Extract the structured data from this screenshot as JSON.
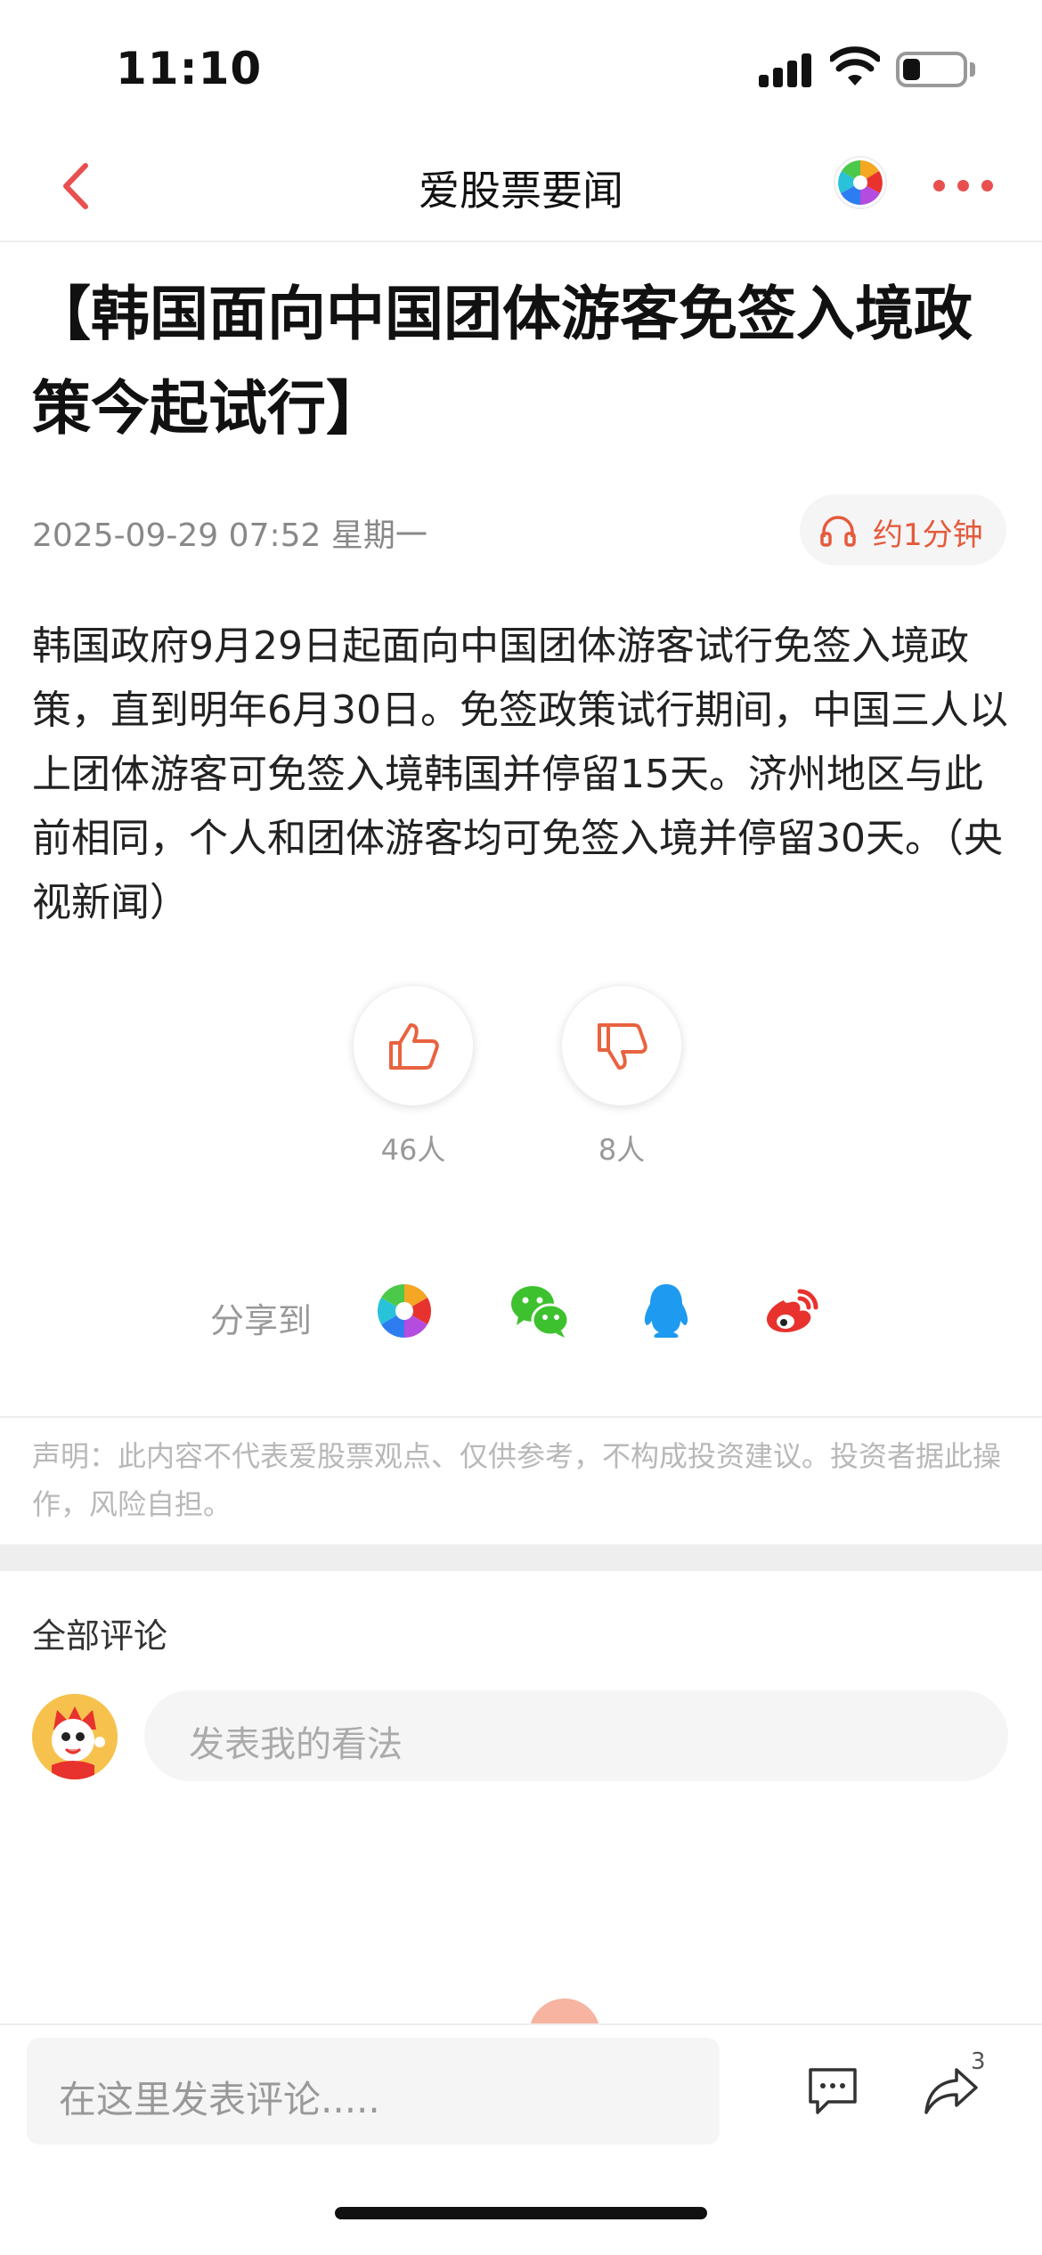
{
  "status_bar": {
    "time": "11:10",
    "battery_level": 0.3
  },
  "nav": {
    "title": "爱股票要闻"
  },
  "article": {
    "title": "【韩国面向中国团体游客免签入境政策今起试行】",
    "date": "2025-09-29 07:52  星期一",
    "audio_label": "约1分钟",
    "body": "韩国政府9月29日起面向中国团体游客试行免签入境政策，直到明年6月30日。免签政策试行期间，中国三人以上团体游客可免签入境韩国并停留15天。济州地区与此前相同，个人和团体游客均可免签入境并停留30天。（央视新闻）"
  },
  "reactions": {
    "like_count": "46人",
    "dislike_count": "8人"
  },
  "share": {
    "label": "分享到",
    "targets": [
      "app-icon",
      "wechat-icon",
      "qq-icon",
      "weibo-icon"
    ]
  },
  "disclaimer": "声明：此内容不代表爱股票观点、仅供参考，不构成投资建议。投资者据此操作，风险自担。",
  "comments": {
    "heading": "全部评论",
    "input_placeholder": "发表我的看法"
  },
  "bottom_bar": {
    "input_placeholder": "在这里发表评论.....",
    "share_count": "3"
  },
  "colors": {
    "accent": "#e55a3b",
    "like_icon": "#e8633f",
    "wechat": "#3ec12e",
    "qq": "#1e9bf0",
    "weibo": "#e8322e"
  }
}
